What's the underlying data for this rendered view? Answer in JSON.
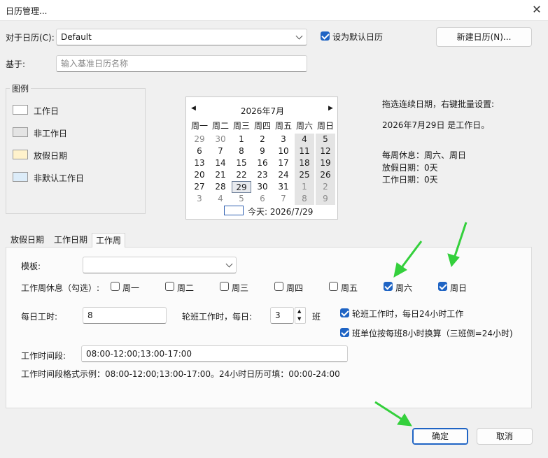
{
  "window": {
    "title": "日历管理..."
  },
  "calendar_select": {
    "label": "对于日历(C):",
    "value": "Default"
  },
  "default_checkbox": {
    "label": "设为默认日历",
    "checked": true
  },
  "new_calendar_button": "新建日历(N)...",
  "based_on": {
    "label": "基于:",
    "placeholder": "输入基准日历名称"
  },
  "legend": {
    "title": "图例",
    "items": [
      {
        "label": "工作日",
        "color": "#ffffff"
      },
      {
        "label": "非工作日",
        "color": "#e4e4e4"
      },
      {
        "label": "放假日期",
        "color": "#fff2cc"
      },
      {
        "label": "非默认工作日",
        "color": "#dcecf9"
      }
    ]
  },
  "mini_calendar": {
    "month_label": "2026年7月",
    "weekdays": [
      "周一",
      "周二",
      "周三",
      "周四",
      "周五",
      "周六",
      "周日"
    ],
    "weeks": [
      [
        "29",
        "30",
        "1",
        "2",
        "3",
        "4",
        "5"
      ],
      [
        "6",
        "7",
        "8",
        "9",
        "10",
        "11",
        "12"
      ],
      [
        "13",
        "14",
        "15",
        "16",
        "17",
        "18",
        "19"
      ],
      [
        "20",
        "21",
        "22",
        "23",
        "24",
        "25",
        "26"
      ],
      [
        "27",
        "28",
        "29",
        "30",
        "31",
        "1",
        "2"
      ],
      [
        "3",
        "4",
        "5",
        "6",
        "7",
        "8",
        "9"
      ]
    ],
    "selected": "29",
    "today_label": "今天: 2026/7/29"
  },
  "info": {
    "hint": "拖选连续日期，右键批量设置:",
    "date_status": "2026年7月29日 是工作日。",
    "weekly_rest": "每周休息：周六、周日",
    "holiday_days": "放假日期：0天",
    "work_days": "工作日期：0天"
  },
  "tabs": [
    {
      "label": "放假日期",
      "active": false
    },
    {
      "label": "工作日期",
      "active": false
    },
    {
      "label": "工作周",
      "active": true
    }
  ],
  "workweek": {
    "template_label": "模板:",
    "template_value": "",
    "rest_label": "工作周休息（勾选）:",
    "days": [
      {
        "label": "周一",
        "checked": false
      },
      {
        "label": "周二",
        "checked": false
      },
      {
        "label": "周三",
        "checked": false
      },
      {
        "label": "周四",
        "checked": false
      },
      {
        "label": "周五",
        "checked": false
      },
      {
        "label": "周六",
        "checked": true
      },
      {
        "label": "周日",
        "checked": true
      }
    ],
    "daily_hours_label": "每日工时:",
    "daily_hours_value": "8",
    "shift_label": "轮班工作时，每日:",
    "shift_value": "3",
    "shift_unit": "班",
    "shift_24h": {
      "label": "轮班工作时，每日24小时工作",
      "checked": true
    },
    "shift_8h": {
      "label": "班单位按每班8小时换算（三班倒=24小时)",
      "checked": true
    },
    "periods_label": "工作时间段:",
    "periods_value": "08:00-12:00;13:00-17:00",
    "format_hint": "工作时间段格式示例：08:00-12:00;13:00-17:00。24小时日历可填：00:00-24:00"
  },
  "footer": {
    "ok": "确定",
    "cancel": "取消"
  },
  "accent_color": "#1f64c4",
  "annotation_color": "#34d03c"
}
